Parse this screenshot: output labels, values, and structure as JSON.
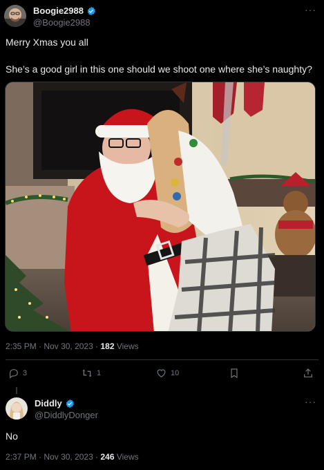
{
  "post": {
    "author": {
      "name": "Boogie2988",
      "handle": "@Boogie2988",
      "verified": true
    },
    "text_line1": "Merry Xmas you all",
    "text_line2": "She’s a good girl in this one should we shoot one where she’s naughty?",
    "time": "2:35 PM",
    "date": "Nov 30, 2023",
    "views_count": "182",
    "views_label": "Views",
    "actions": {
      "replies": "3",
      "reposts": "1",
      "likes": "10"
    },
    "more_label": "···"
  },
  "reply": {
    "author": {
      "name": "Diddly",
      "handle": "@DiddlyDonger",
      "verified": true
    },
    "text": "No",
    "time": "2:37 PM",
    "date": "Nov 30, 2023",
    "views_count": "246",
    "views_label": "Views",
    "more_label": "···"
  },
  "colors": {
    "background": "#000000",
    "text": "#e7e9ea",
    "muted": "#71767b",
    "verified": "#1d9bf0",
    "border": "#2f3336"
  }
}
